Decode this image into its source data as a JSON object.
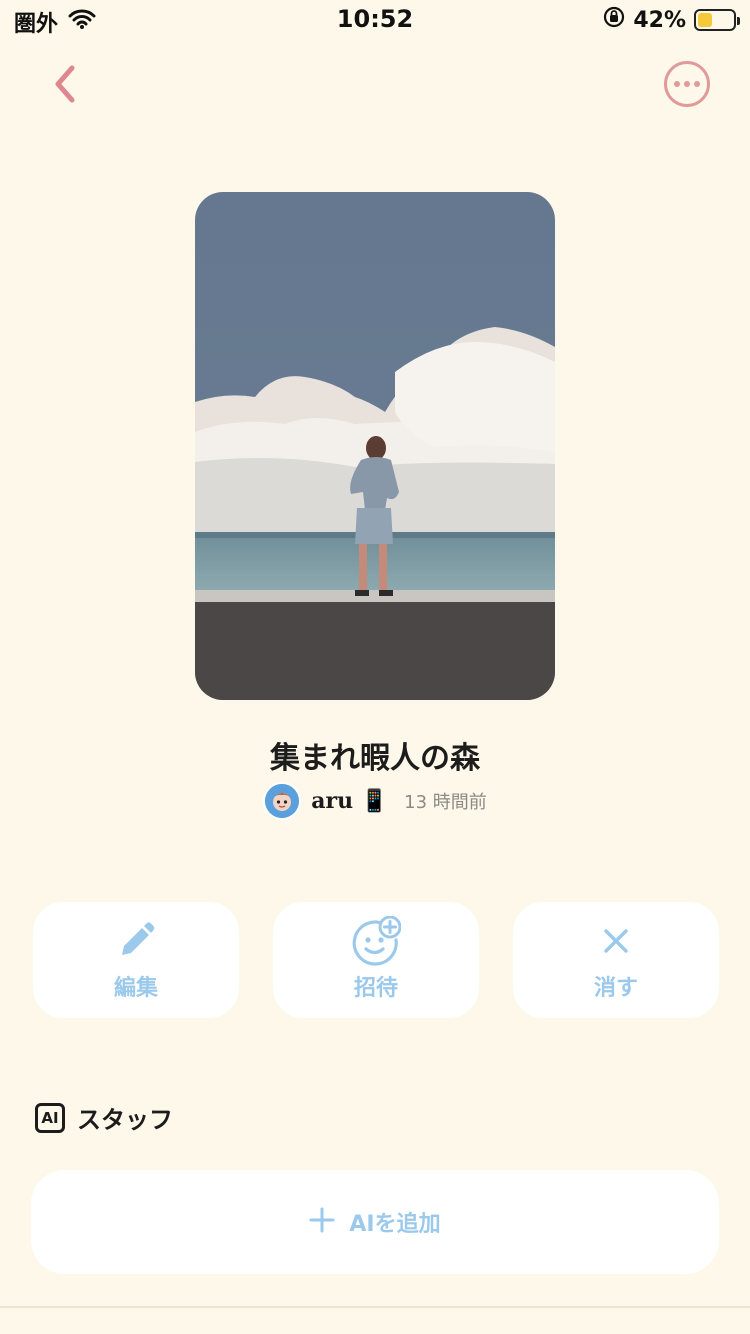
{
  "status_bar": {
    "carrier": "圏外",
    "time": "10:52",
    "battery": "42%",
    "battery_level": 0.42
  },
  "group": {
    "title": "集まれ暇人の森",
    "author": "aru 📱",
    "time_ago": "13 時間前"
  },
  "actions": [
    {
      "label": "編集",
      "icon": "pencil-icon"
    },
    {
      "label": "招待",
      "icon": "add-friend-icon"
    },
    {
      "label": "消す",
      "icon": "close-icon"
    }
  ],
  "ai_section": {
    "badge": "AI",
    "title": "スタッフ",
    "add_label": "AIを追加"
  },
  "colors": {
    "background": "#fdf8e9",
    "accent_pink": "#e09a9a",
    "accent_blue": "#9bc9ec"
  }
}
